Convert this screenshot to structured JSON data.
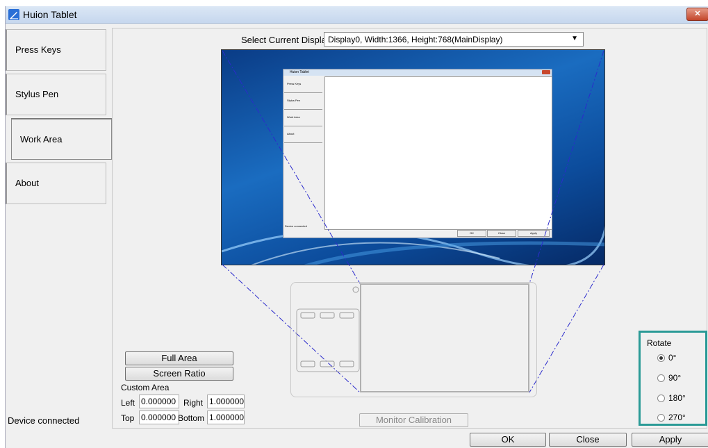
{
  "window": {
    "title": "Huion Tablet",
    "close_glyph": "✕"
  },
  "sidebar": {
    "items": [
      {
        "label": "Press Keys"
      },
      {
        "label": "Stylus Pen"
      },
      {
        "label": "Work Area"
      },
      {
        "label": "About"
      }
    ],
    "active": "Work Area"
  },
  "status": {
    "text": "Device connected"
  },
  "display": {
    "label": "Select Current Display",
    "value": "Display0, Width:1366, Height:768(MainDisplay)"
  },
  "preview": {
    "title": "Huion Tablet",
    "tabs": [
      "Press Keys",
      "Stylus Pen",
      "Work Area",
      "About"
    ],
    "status": "Device connected",
    "buttons": [
      "OK",
      "Close",
      "Apply"
    ]
  },
  "area_buttons": {
    "full_area": "Full Area",
    "screen_ratio": "Screen Ratio"
  },
  "custom_area": {
    "label": "Custom Area",
    "left_label": "Left",
    "left": "0.000000",
    "right_label": "Right",
    "right": "1.000000",
    "top_label": "Top",
    "top": "0.000000",
    "bottom_label": "Bottom",
    "bottom": "1.000000"
  },
  "monitor_calibration": "Monitor Calibration",
  "rotate": {
    "label": "Rotate",
    "options": [
      "0°",
      "90°",
      "180°",
      "270°"
    ],
    "selected": "0°"
  },
  "footer": {
    "ok": "OK",
    "close": "Close",
    "apply": "Apply"
  },
  "colors": {
    "accent": "#2a9a96",
    "guide_line": "#2b2bcc"
  }
}
